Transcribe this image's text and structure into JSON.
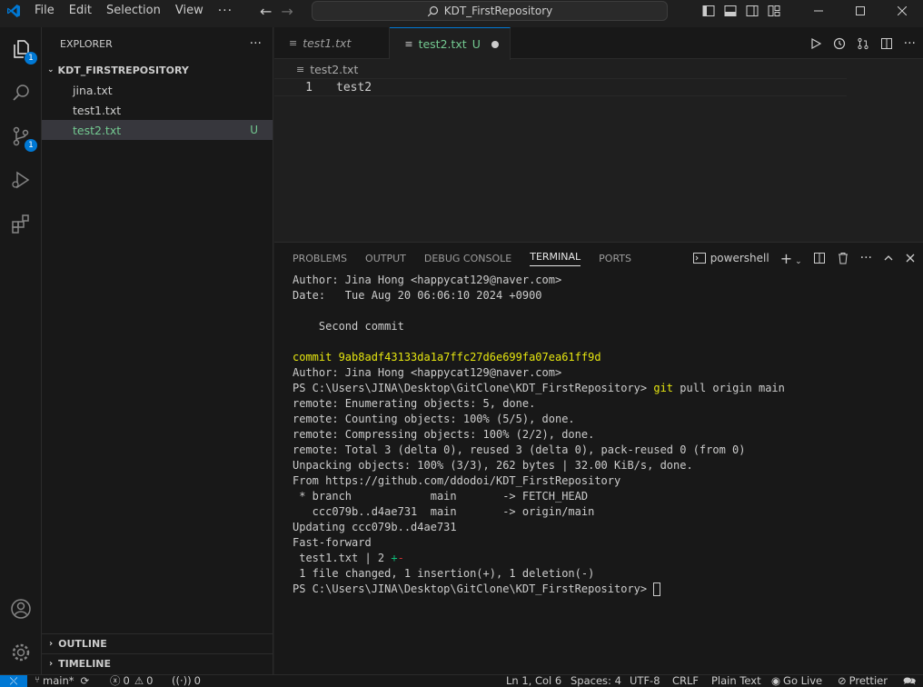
{
  "titlebar": {
    "menu": [
      "File",
      "Edit",
      "Selection",
      "View"
    ],
    "more": "···",
    "search": "KDT_FirstRepository"
  },
  "activity": {
    "explorer_badge": "1",
    "scm_badge": "1"
  },
  "sidebar": {
    "title": "EXPLORER",
    "more": "···",
    "folder": "KDT_FIRSTREPOSITORY",
    "files": [
      {
        "name": "jina.txt",
        "status": ""
      },
      {
        "name": "test1.txt",
        "status": ""
      },
      {
        "name": "test2.txt",
        "status": "U"
      }
    ],
    "outline": "OUTLINE",
    "timeline": "TIMELINE"
  },
  "editor": {
    "tabs": [
      {
        "label": "test1.txt",
        "status": ""
      },
      {
        "label": "test2.txt",
        "status": "U"
      }
    ],
    "breadcrumb": "test2.txt",
    "line_number": "1",
    "code": "test2"
  },
  "panel": {
    "tabs": [
      "PROBLEMS",
      "OUTPUT",
      "DEBUG CONSOLE",
      "TERMINAL",
      "PORTS"
    ],
    "active_tab": "TERMINAL",
    "shell": "powershell",
    "terminal": {
      "l1": "Author: Jina Hong <happycat129@naver.com>",
      "l2": "Date:   Tue Aug 20 06:06:10 2024 +0900",
      "l3": "",
      "l4": "    Second commit",
      "l5": "",
      "l6": "commit 9ab8adf43133da1a7ffc27d6e699fa07ea61ff9d",
      "l7": "Author: Jina Hong <happycat129@naver.com>",
      "l8_prompt": "PS C:\\Users\\JINA\\Desktop\\GitClone\\KDT_FirstRepository> ",
      "l8_cmd": "git",
      "l8_args": " pull origin main",
      "l9": "remote: Enumerating objects: 5, done.",
      "l10": "remote: Counting objects: 100% (5/5), done.",
      "l11": "remote: Compressing objects: 100% (2/2), done.",
      "l12": "remote: Total 3 (delta 0), reused 3 (delta 0), pack-reused 0 (from 0)",
      "l13": "Unpacking objects: 100% (3/3), 262 bytes | 32.00 KiB/s, done.",
      "l14": "From https://github.com/ddodoi/KDT_FirstRepository",
      "l15": " * branch            main       -> FETCH_HEAD",
      "l16": "   ccc079b..d4ae731  main       -> origin/main",
      "l17": "Updating ccc079b..d4ae731",
      "l18": "Fast-forward",
      "l19_a": " test1.txt | 2 ",
      "l19_plus": "+",
      "l19_minus": "-",
      "l20": " 1 file changed, 1 insertion(+), 1 deletion(-)",
      "l21_prompt": "PS C:\\Users\\JINA\\Desktop\\GitClone\\KDT_FirstRepository> "
    }
  },
  "statusbar": {
    "branch": "main*",
    "errors": "0",
    "warnings": "0",
    "ports": "0",
    "position": "Ln 1, Col 6",
    "spaces": "Spaces: 4",
    "encoding": "UTF-8",
    "eol": "CRLF",
    "language": "Plain Text",
    "golive": "Go Live",
    "prettier": "Prettier"
  },
  "colors": {
    "accent": "#0078d4",
    "untracked": "#73c991",
    "terminal_yellow": "#e5e510",
    "terminal_green": "#0dbc79",
    "terminal_red": "#cd3131"
  }
}
